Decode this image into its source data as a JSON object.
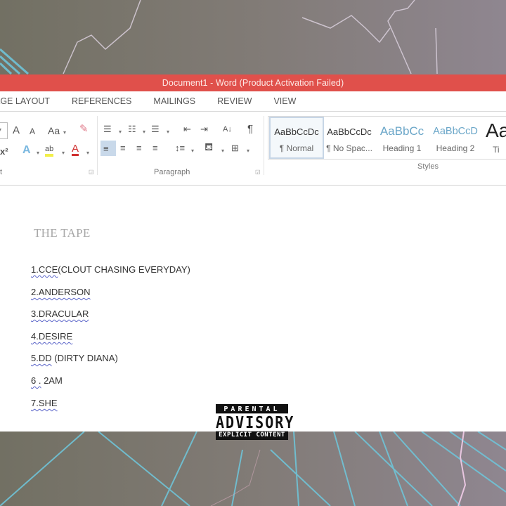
{
  "window": {
    "title": "Document1 -  Word (Product Activation Failed)"
  },
  "ribbon_tabs": [
    "AGE LAYOUT",
    "REFERENCES",
    "MAILINGS",
    "REVIEW",
    "VIEW"
  ],
  "ribbon": {
    "font_group_label": "t",
    "paragraph_group_label": "Paragraph",
    "styles_group_label": "Styles",
    "font_icons": {
      "grow": "A",
      "shrink": "A",
      "change_case": "Aa",
      "superscript": "x²",
      "text_effects": "A",
      "highlight": "ab",
      "font_color": "A"
    },
    "paragraph_icons": {
      "sort": "A↓",
      "show_marks": "¶"
    },
    "styles": [
      {
        "preview": "AaBbCcDc",
        "name": "¶ Normal",
        "selected": true,
        "color": "#333333"
      },
      {
        "preview": "AaBbCcDc",
        "name": "¶ No Spac...",
        "selected": false,
        "color": "#333333"
      },
      {
        "preview": "AaBbCc",
        "name": "Heading 1",
        "selected": false,
        "color": "#6aa6c8"
      },
      {
        "preview": "AaBbCcD",
        "name": "Heading 2",
        "selected": false,
        "color": "#6aa6c8"
      },
      {
        "preview": "Aa",
        "name": "Ti",
        "selected": false,
        "color": "#222222"
      }
    ]
  },
  "document": {
    "title": "THE TAPE",
    "tracks": [
      {
        "num": "1.CCE",
        "rest": "(CLOUT CHASING EVERYDAY)"
      },
      {
        "num": "2.ANDERSON",
        "rest": ""
      },
      {
        "num": "3.DRACULAR",
        "rest": ""
      },
      {
        "num": "4.DESIRE",
        "rest": ""
      },
      {
        "num": "5.DD",
        "rest": " (DIRTY DIANA)"
      },
      {
        "num": "6 .",
        "rest": " 2AM"
      },
      {
        "num": "7.SHE",
        "rest": ""
      }
    ]
  },
  "advisory": {
    "line1": "PARENTAL",
    "line2": "ADVISORY",
    "line3": "EXPLICIT CONTENT"
  },
  "colors": {
    "titlebar": "#e0504b",
    "grid_lines": "#6fc4d8",
    "lightning": "#e6d4ea"
  }
}
